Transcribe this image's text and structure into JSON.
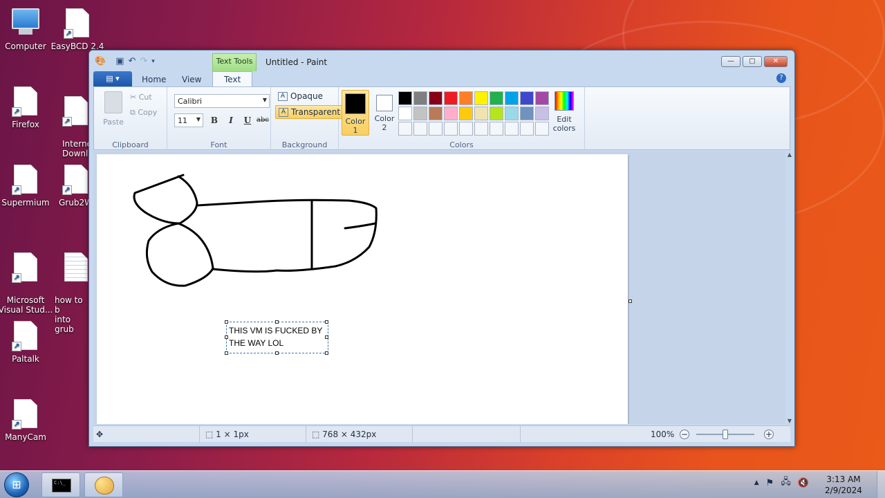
{
  "desktop": {
    "icons": [
      {
        "label": "Computer",
        "kind": "computer-icon"
      },
      {
        "label": "EasyBCD 2.4",
        "kind": "file-shortcut-icon"
      },
      {
        "label": "Firefox",
        "kind": "file-shortcut-icon"
      },
      {
        "label": "Interne\nDownlo",
        "kind": "file-shortcut-icon"
      },
      {
        "label": "Supermium",
        "kind": "file-shortcut-icon"
      },
      {
        "label": "Grub2W",
        "kind": "file-shortcut-icon"
      },
      {
        "label": "Microsoft\nVisual Stud...",
        "kind": "file-shortcut-icon"
      },
      {
        "label": "how to b\ninto grub",
        "kind": "text-file-icon"
      },
      {
        "label": "Paltalk",
        "kind": "file-shortcut-icon"
      },
      {
        "label": "ManyCam",
        "kind": "file-shortcut-icon"
      }
    ]
  },
  "window": {
    "context_tab": "Text Tools",
    "title": "Untitled - Paint",
    "buttons": {
      "minimize": "—",
      "maximize": "▢",
      "close": "✕"
    },
    "tabs": {
      "file": "▤ ▾",
      "home": "Home",
      "view": "View",
      "text": "Text"
    },
    "help": "?"
  },
  "ribbon": {
    "clipboard": {
      "paste": "Paste",
      "cut": "Cut",
      "copy": "Copy",
      "label": "Clipboard"
    },
    "font": {
      "family": "Calibri",
      "size": "11",
      "bold": "B",
      "italic": "I",
      "underline": "U",
      "strike": "abc",
      "label": "Font"
    },
    "background": {
      "opaque": "Opaque",
      "transparent": "Transparent",
      "label": "Background"
    },
    "colors": {
      "color1": "Color\n1",
      "color2": "Color\n2",
      "edit": "Edit\ncolors",
      "label": "Colors",
      "color1_value": "#000000",
      "color2_value": "#ffffff",
      "palette": [
        "#000000",
        "#7f7f7f",
        "#880015",
        "#ed1c24",
        "#ff7f27",
        "#fff200",
        "#22b14c",
        "#00a2e8",
        "#3f48cc",
        "#a349a4",
        "#ffffff",
        "#c3c3c3",
        "#b97a57",
        "#ffaec9",
        "#ffc90e",
        "#efe4b0",
        "#b5e61d",
        "#99d9ea",
        "#7092be",
        "#c8bfe7",
        "",
        "",
        "",
        "",
        "",
        "",
        "",
        "",
        "",
        ""
      ]
    }
  },
  "canvas": {
    "textbox_text": "THIS VM IS FUCKED BY THE WAY LOL"
  },
  "statusbar": {
    "move_icon": "✥",
    "selection_size": "1 × 1px",
    "canvas_size": "768 × 432px",
    "zoom": "100%",
    "zoom_out": "−",
    "zoom_in": "+"
  },
  "taskbar": {
    "start": "⊞",
    "cmd_text": "C:\\_",
    "time": "3:13 AM",
    "date": "2/9/2024"
  }
}
